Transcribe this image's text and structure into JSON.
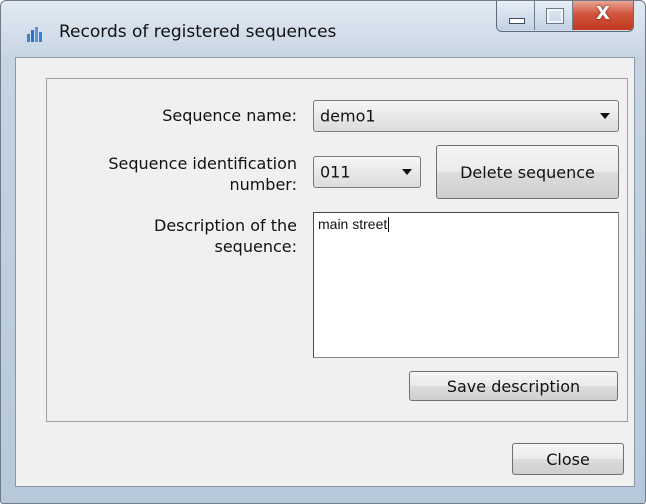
{
  "window": {
    "title": "Records of registered sequences",
    "icon": "bar-chart-icon",
    "accent_color": "#c2381f"
  },
  "controls": {
    "minimize_icon": "minimize-icon",
    "maximize_icon": "maximize-icon",
    "close_glyph": "X"
  },
  "form": {
    "sequence_name_label": "Sequence name:",
    "sequence_name_value": "demo1",
    "sequence_id_label_line1": "Sequence identification",
    "sequence_id_label_line2": "number:",
    "sequence_id_value": "011",
    "delete_button": "Delete sequence",
    "description_label_line1": "Description of the",
    "description_label_line2": "sequence:",
    "description_value": "main street",
    "save_button": "Save description"
  },
  "footer": {
    "close_button": "Close"
  }
}
